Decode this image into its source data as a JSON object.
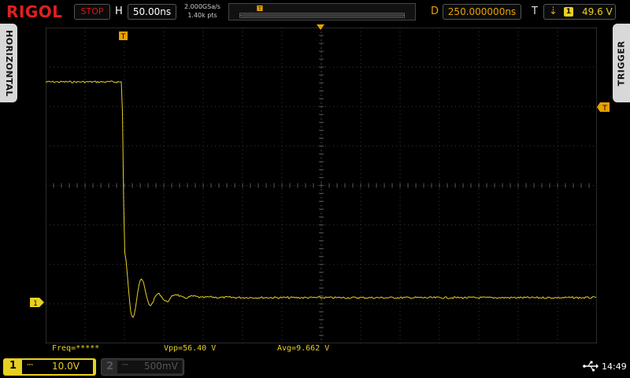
{
  "brand": "RIGOL",
  "status": "STOP",
  "horizontal": {
    "label": "H",
    "timebase": "50.00ns",
    "sample_rate": "2.000GSa/s",
    "points": "1.40k pts"
  },
  "delay": {
    "label": "D",
    "value": "250.000000ns"
  },
  "trigger": {
    "label": "T",
    "slope_icon": "falling-edge-icon",
    "source": "1",
    "level": "49.6 V"
  },
  "side_tabs": {
    "left": "HORIZONTAL",
    "right": "TRIGGER"
  },
  "markers": {
    "trigger_position": "T",
    "trigger_level": "T",
    "channel1_ground": "1"
  },
  "measurements": {
    "freq": "Freq=*****",
    "vpp": "Vpp=56.40 V",
    "avg": "Avg=9.662 V"
  },
  "channel1": {
    "number": "1",
    "coupling": "⎓",
    "scale": "10.0V"
  },
  "channel2": {
    "number": "2",
    "coupling": "⎓",
    "scale": "500mV"
  },
  "clock": "14:49",
  "colors": {
    "ch1": "#e8d020",
    "trigger": "#e8a000",
    "stop": "#d01818",
    "grid": "#3a3a3a"
  }
}
